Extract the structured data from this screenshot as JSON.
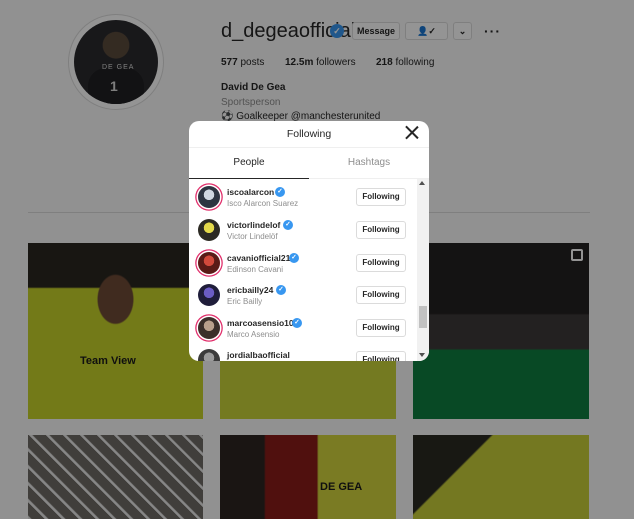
{
  "profile": {
    "username": "d_degeaofficial",
    "message_button": "Message",
    "follow_icon": "person-check-icon",
    "more_icon": "ellipsis-icon",
    "posts_count": "577",
    "posts_label": "posts",
    "followers_count": "12.5m",
    "followers_label": "followers",
    "following_count": "218",
    "following_label": "following",
    "full_name": "David De Gea",
    "category": "Sportsperson",
    "bio": "⚽ Goalkeeper @manchesterunited"
  },
  "modal": {
    "title": "Following",
    "tabs": [
      {
        "label": "People",
        "active": true
      },
      {
        "label": "Hashtags",
        "active": false
      }
    ],
    "rows": [
      {
        "handle": "iscoalarcon",
        "name": "Isco Alarcon Suarez",
        "button": "Following",
        "story_ring": true
      },
      {
        "handle": "victorlindelof",
        "name": "Victor Lindelöf",
        "button": "Following",
        "story_ring": false
      },
      {
        "handle": "cavaniofficial21",
        "name": "Edinson Cavani",
        "button": "Following",
        "story_ring": true
      },
      {
        "handle": "ericbailly24",
        "name": "Eric Bailly",
        "button": "Following",
        "story_ring": false
      },
      {
        "handle": "marcoasensio10",
        "name": "Marco Asensio",
        "button": "Following",
        "story_ring": true
      },
      {
        "handle": "jordialbaofficial",
        "name": "",
        "button": "Following",
        "story_ring": false
      }
    ]
  },
  "posts": [
    {
      "label": "Team View"
    },
    {
      "label": ""
    },
    {
      "label": ""
    },
    {
      "label": ""
    },
    {
      "label": "DE GEA"
    },
    {
      "label": ""
    }
  ],
  "colors": {
    "verified": "#3897f0",
    "story_ring": "#e1306c",
    "overlay": "rgba(0,0,0,0.42)"
  }
}
